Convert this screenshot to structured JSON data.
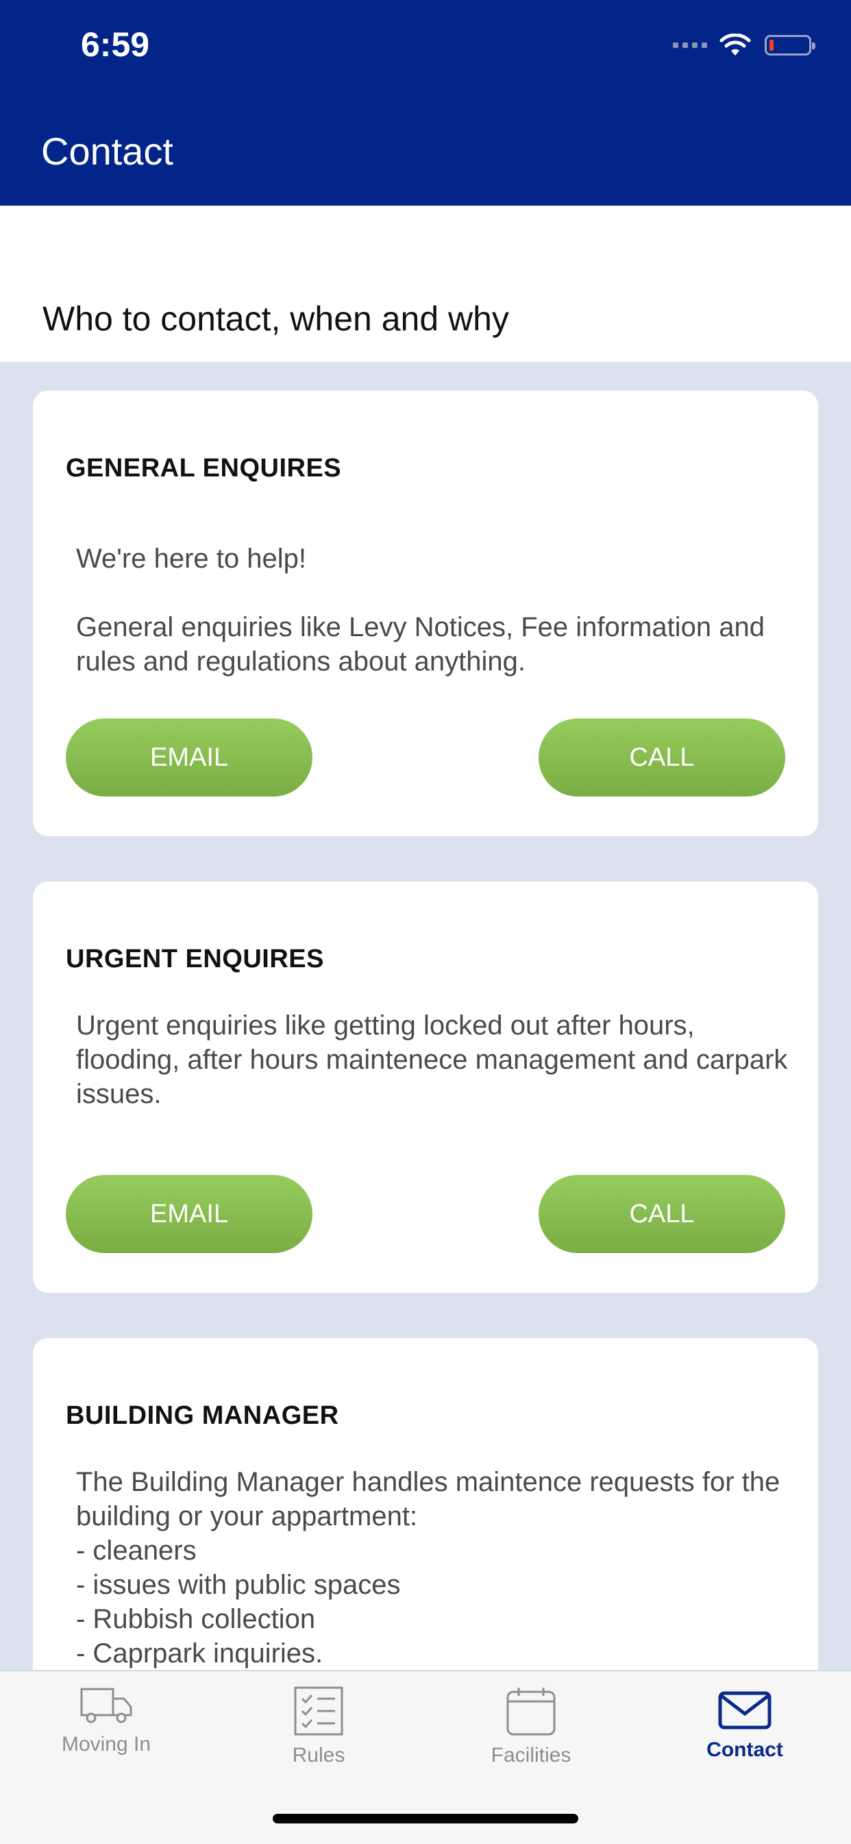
{
  "status_bar": {
    "time": "6:59"
  },
  "header": {
    "title": "Contact"
  },
  "subheader": {
    "text": "Who to contact, when and why"
  },
  "cards": [
    {
      "title": "GENERAL ENQUIRES",
      "body": "We're here to help!\n\nGeneral enquiries like Levy Notices, Fee information and rules and regulations about anything.",
      "email_label": "EMAIL",
      "call_label": "CALL"
    },
    {
      "title": "URGENT ENQUIRES",
      "body": "Urgent enquiries like getting locked out after hours, flooding, after hours maintenece management and carpark issues.",
      "email_label": "EMAIL",
      "call_label": "CALL"
    },
    {
      "title": "BUILDING MANAGER",
      "body": "The Building Manager handles maintence requests for the building or your appartment:\n- cleaners\n- issues with public spaces\n- Rubbish collection\n- Caprpark inquiries."
    }
  ],
  "tabs": [
    {
      "label": "Moving In",
      "icon": "truck-icon"
    },
    {
      "label": "Rules",
      "icon": "checklist-icon"
    },
    {
      "label": "Facilities",
      "icon": "calendar-icon"
    },
    {
      "label": "Contact",
      "icon": "envelope-icon",
      "active": true
    }
  ],
  "colors": {
    "header": "#03258a",
    "button": "#86bb4f",
    "active_tab": "#0a2a8c",
    "background": "#dbe1ee"
  }
}
